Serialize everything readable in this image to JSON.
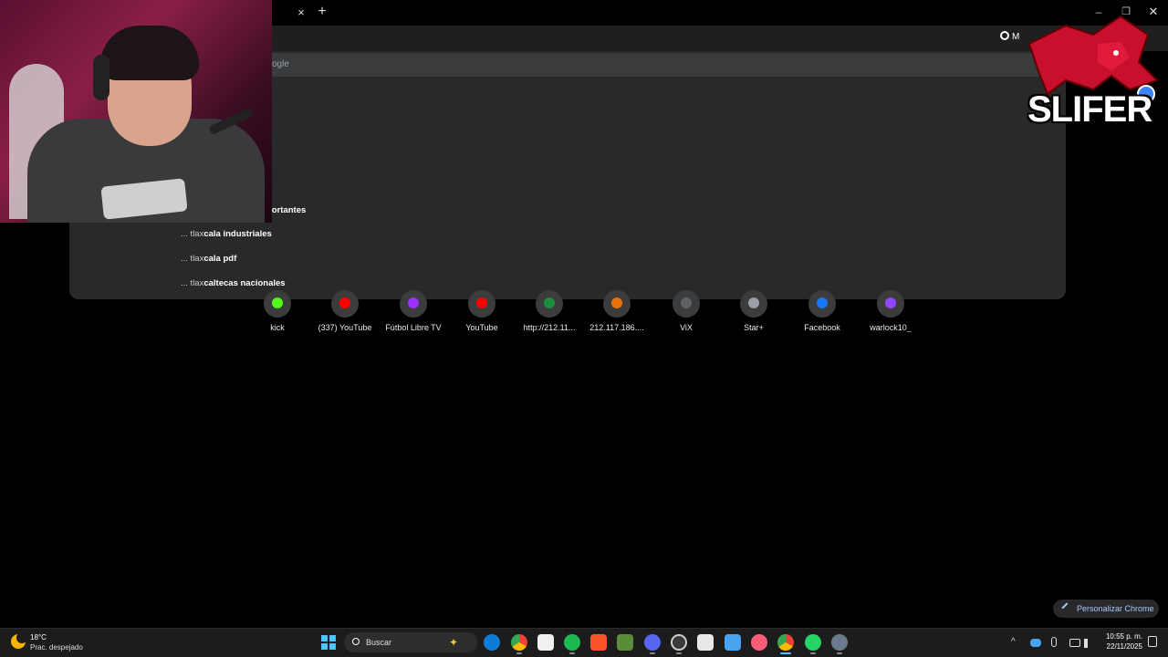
{
  "browser": {
    "tab_close_glyph": "×",
    "new_tab_glyph": "+",
    "window_minimize_glyph": "–",
    "window_maximize_glyph": "❐",
    "window_close_glyph": "✕",
    "search_chip_label": "M"
  },
  "omnibox": {
    "hint_text": "ogle",
    "suggestions": [
      {
        "prefix": "... tlax",
        "bold": "cala industriales"
      },
      {
        "prefix": "... tlax",
        "bold": "cala pdf"
      },
      {
        "prefix": "... tlax",
        "bold": "caltecas nacionales"
      }
    ],
    "partial_suggestion_fragment": "portantes"
  },
  "shortcuts": [
    {
      "label": "kick",
      "color": "#53fc18"
    },
    {
      "label": "(337) YouTube",
      "color": "#ff0000"
    },
    {
      "label": "Fútbol Libre TV",
      "color": "#9b30ff"
    },
    {
      "label": "YouTube",
      "color": "#ff0000"
    },
    {
      "label": "http://212.11...",
      "color": "#1e8e3e"
    },
    {
      "label": "212.117.186....",
      "color": "#e8710a"
    },
    {
      "label": "ViX",
      "color": "#5f6368"
    },
    {
      "label": "Star+",
      "color": "#9aa0a6"
    },
    {
      "label": "Facebook",
      "color": "#1877f2"
    },
    {
      "label": "warlock10_",
      "color": "#9146ff"
    }
  ],
  "overlay": {
    "logo_text": "SLIFER"
  },
  "customize_button": {
    "label": "Personalizar Chrome"
  },
  "taskbar": {
    "weather_temp": "18°C",
    "weather_desc": "Prac. despejado",
    "search_placeholder": "Buscar",
    "clock_time": "10:55 p. m.",
    "clock_date": "22/11/2025",
    "tray_chevron": "^"
  },
  "colors": {
    "accent": "#a8c7fa",
    "windows_blue": "#4cc2ff"
  }
}
